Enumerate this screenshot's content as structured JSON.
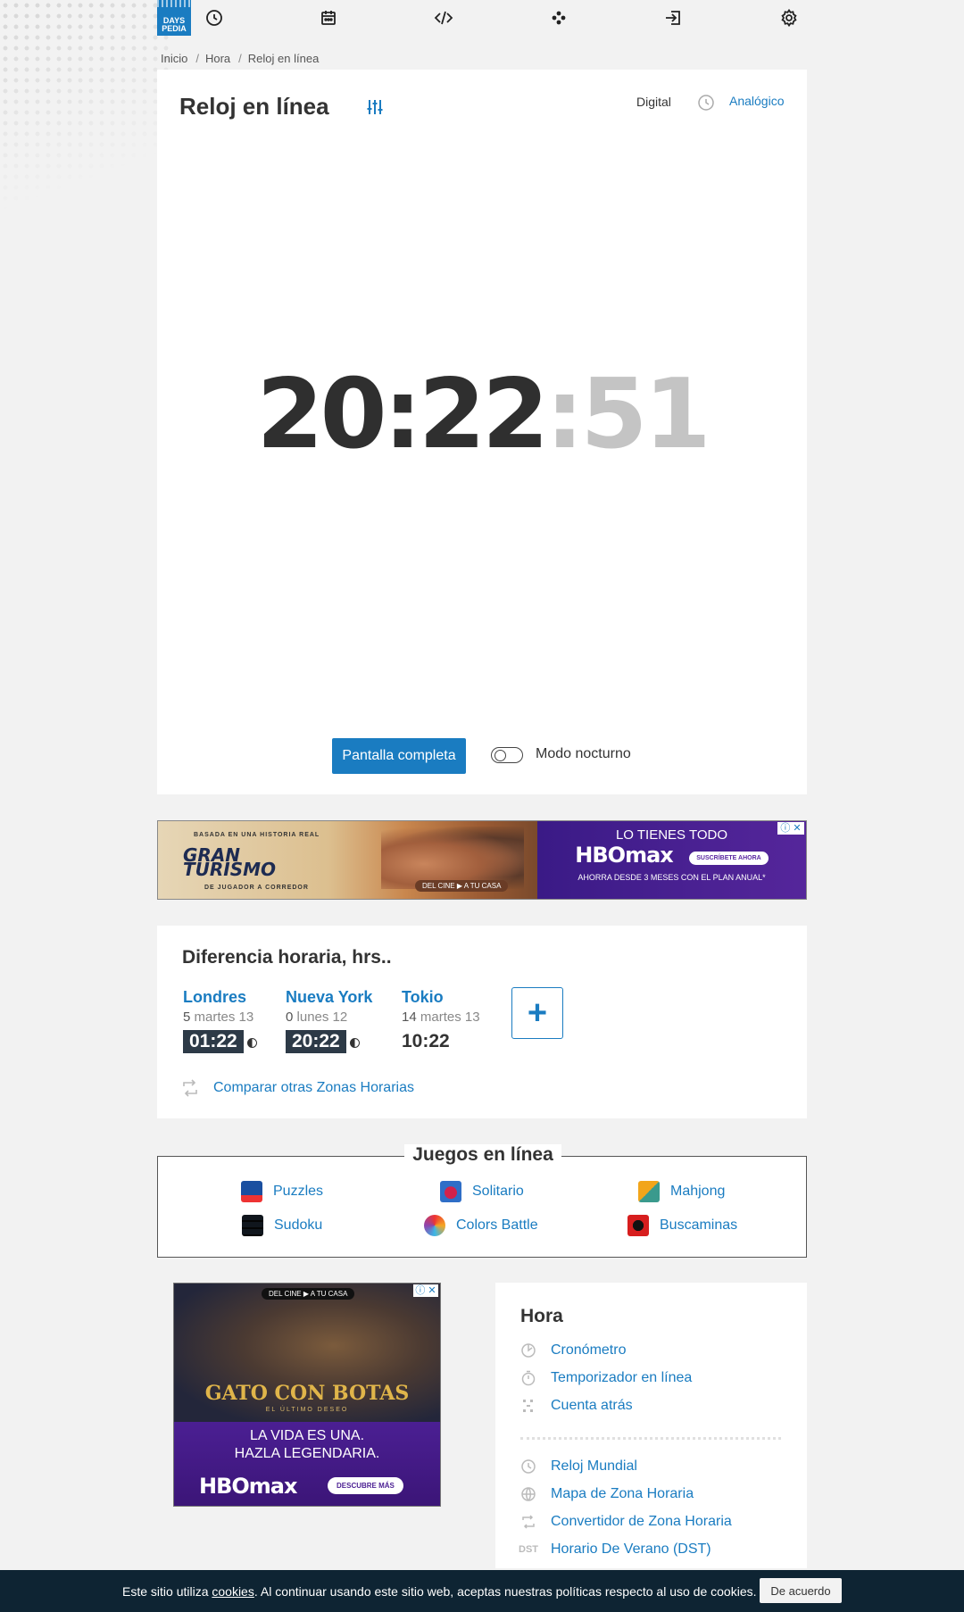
{
  "nav": {
    "logo_line1": "DAYS",
    "logo_line2": "PEDIA",
    "icons": [
      "clock-icon",
      "calendar-icon",
      "code-icon",
      "games-icon",
      "login-icon",
      "gear-icon"
    ]
  },
  "breadcrumb": [
    "Inicio",
    "Hora",
    "Reloj en línea"
  ],
  "clock": {
    "title": "Reloj en línea",
    "mode_digital": "Digital",
    "mode_analog": "Analógico",
    "hours_minutes": "20:22",
    "seconds": ":51",
    "fullscreen_label": "Pantalla completa",
    "night_mode_label": "Modo nocturno",
    "night_mode_on": false
  },
  "ad_top": {
    "gt_tag": "BASADA EN UNA HISTORIA REAL",
    "gt_title_1": "GRAN",
    "gt_title_2": "TURISMO",
    "gt_sub": "DE JUGADOR A CORREDOR",
    "cine_tag": "DEL CINE ▶ A TU CASA",
    "hbo_headline": "LO TIENES TODO",
    "hbo_logo": "HBOmax",
    "hbo_pill": "SUSCRÍBETE AHORA",
    "hbo_offer": "AHORRA DESDE 3 MESES CON EL PLAN ANUAL*",
    "close": "ⓘ ✕"
  },
  "time_diff": {
    "title": "Diferencia horaria, hrs..",
    "cities": [
      {
        "name": "Londres",
        "offset": "5",
        "day": "martes 13",
        "time": "01:22",
        "night": true
      },
      {
        "name": "Nueva York",
        "offset": "0",
        "day": "lunes 12",
        "time": "20:22",
        "night": true
      },
      {
        "name": "Tokio",
        "offset": "14",
        "day": "martes 13",
        "time": "10:22",
        "night": false
      }
    ],
    "add_label": "+",
    "compare_label": "Comparar otras Zonas Horarias"
  },
  "games": {
    "title": "Juegos en línea",
    "items": [
      "Puzzles",
      "Solitario",
      "Mahjong",
      "Sudoku",
      "Colors Battle",
      "Buscaminas"
    ]
  },
  "ad_bottom": {
    "cine_tag": "DEL CINE ▶ A TU CASA",
    "title": "GATO CON BOTAS",
    "subtitle": "EL ÚLTIMO DESEO",
    "line1": "LA VIDA ES UNA.",
    "line2": "HAZLA LEGENDARIA.",
    "hbo_logo": "HBOmax",
    "pill": "DESCUBRE MÁS",
    "close": "ⓘ ✕"
  },
  "sidebar": {
    "title": "Hora",
    "items_top": [
      "Cronómetro",
      "Temporizador en línea",
      "Cuenta atrás"
    ],
    "items_bottom": [
      "Reloj Mundial",
      "Mapa de Zona Horaria",
      "Convertidor de Zona Horaria",
      "Horario De Verano (DST)"
    ],
    "dst_glyph": "DST"
  },
  "cookie": {
    "text_before": "Este sitio utiliza ",
    "link": "cookies",
    "text_after": ". Al continuar usando este sitio web, aceptas nuestras políticas respecto al uso de cookies.",
    "button": "De acuerdo"
  },
  "colors": {
    "accent": "#1a7cc1",
    "dark_time_bg": "#2d3a47",
    "cookie_bg": "#0e2433",
    "page_bg": "#f2f2f2"
  }
}
